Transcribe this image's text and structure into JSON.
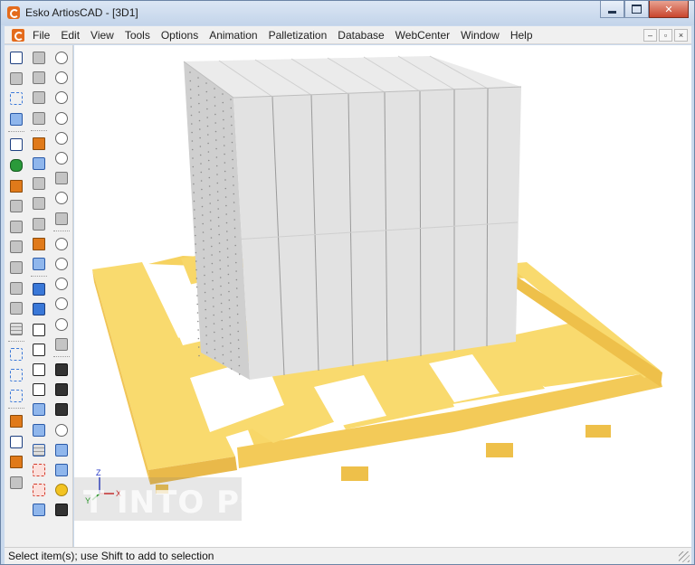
{
  "window": {
    "title": "Esko ArtiosCAD - [3D1]"
  },
  "menu": {
    "items": [
      "File",
      "Edit",
      "View",
      "Tools",
      "Options",
      "Animation",
      "Palletization",
      "Database",
      "WebCenter",
      "Window",
      "Help"
    ],
    "mdi_minimize": "–",
    "mdi_restore": "▫",
    "mdi_close": "×"
  },
  "viewport": {
    "axis_x": "X",
    "axis_y": "Y",
    "axis_z": "Z",
    "watermark": "T INTO PC"
  },
  "status": {
    "text": "Select item(s); use Shift to add to selection"
  },
  "colors": {
    "pallet": "#f9da6e",
    "pallet_shade": "#eec04a",
    "cartons": "#e3e3e3",
    "accent": "#e46b1c"
  },
  "toolbars": {
    "column_1": [
      "select-3d-icon",
      "fold-icon",
      "wire-box-icon",
      "carton-group-icon",
      "select-item-icon",
      "cylinder-icon",
      "pencil-tool-icon",
      "eraser-icon",
      "move-icon",
      "copy-icon",
      "layer-icon",
      "rotate-icon",
      "move-handle-icon",
      "grid-icon",
      "wire-cube-icon",
      "wire-cube-icon",
      "wire-cube-icon",
      "dimension-icon",
      "pointer-plus-icon",
      "measure-icon",
      "snap-icon"
    ],
    "column_2": [
      "magic-wand-icon",
      "rotate-diamond-icon",
      "diamond-icon",
      "diamond-icon",
      "tape-measure-icon",
      "face-icon",
      "clip-icon",
      "clip-icon",
      "lock-icon",
      "rename-icon",
      "carton-icon",
      "solid-cube-icon",
      "solid-cube-icon",
      "outline-cube-icon",
      "outline-cube-icon",
      "outline-cube-icon",
      "outline-cube-icon",
      "half-cube-icon",
      "window-cube-icon",
      "grid-cube-icon",
      "red-cube-icon",
      "red-cube-icon",
      "blue-cube-icon"
    ],
    "column_3": [
      "zoom-window-icon",
      "view-icon",
      "view-icon",
      "view-icon",
      "view-icon",
      "view-icon",
      "swap-icon",
      "view-icon",
      "axis-icon",
      "zoom-in-icon",
      "zoom-out-icon",
      "zoom-icon",
      "zoom-fit-icon",
      "zoom-icon",
      "pan-hand-icon",
      "camera-icon",
      "camera-icon",
      "camera-icon",
      "rotate-view-icon",
      "frame-icon",
      "cube-icon",
      "bulb-icon",
      "eye-icon"
    ]
  }
}
